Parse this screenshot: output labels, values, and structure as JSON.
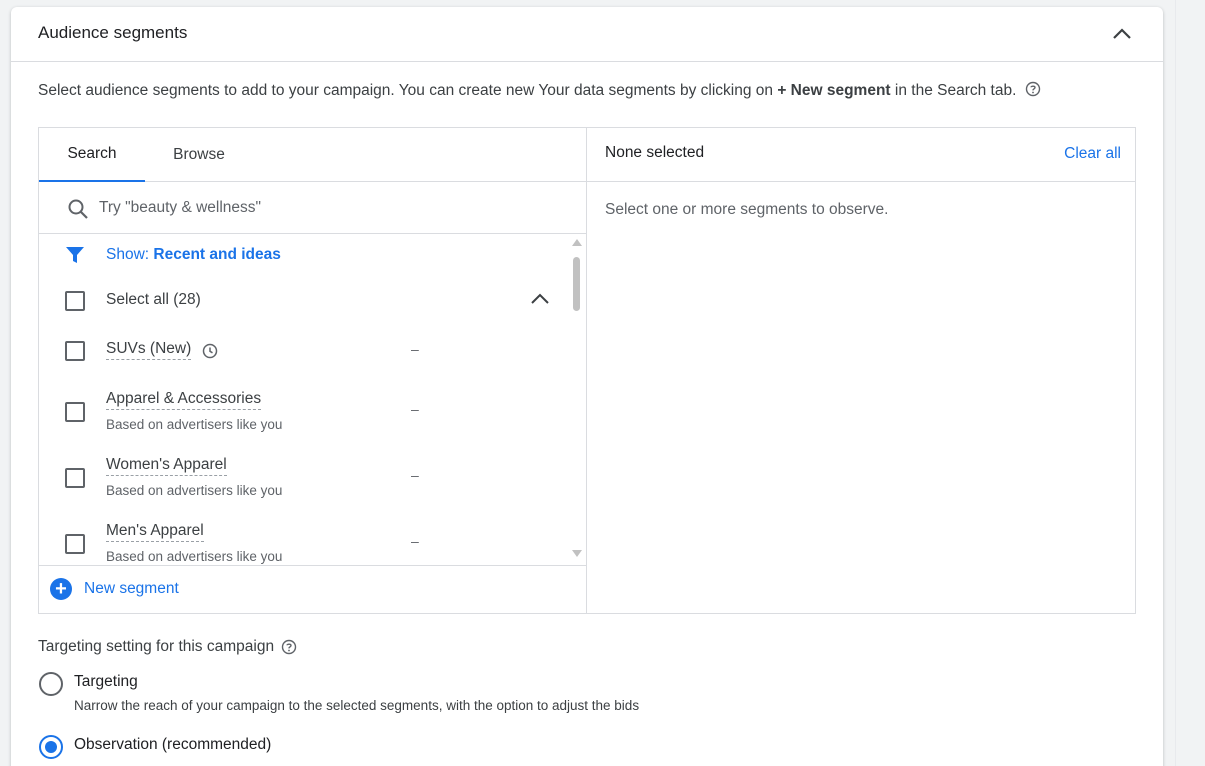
{
  "card": {
    "title": "Audience segments",
    "description_pre": "Select audience segments to add to your campaign. You can create new Your data segments by clicking on ",
    "description_bold": "+ New segment",
    "description_post": " in the Search tab."
  },
  "tabs": [
    {
      "label": "Search",
      "active": true
    },
    {
      "label": "Browse",
      "active": false
    }
  ],
  "search": {
    "placeholder": "Try \"beauty & wellness\""
  },
  "filter": {
    "prefix": "Show: ",
    "value": "Recent and ideas"
  },
  "select_all": {
    "label": "Select all (28)"
  },
  "segments": [
    {
      "name": "SUVs (New)",
      "sub": "",
      "value": "–",
      "has_clock": true
    },
    {
      "name": "Apparel & Accessories",
      "sub": "Based on advertisers like you",
      "value": "–"
    },
    {
      "name": "Women's Apparel",
      "sub": "Based on advertisers like you",
      "value": "–"
    },
    {
      "name": "Men's Apparel",
      "sub": "Based on advertisers like you",
      "value": "–"
    }
  ],
  "new_segment": {
    "label": "New segment"
  },
  "selection": {
    "status": "None selected",
    "clear_label": "Clear all",
    "empty_text": "Select one or more segments to observe."
  },
  "targeting": {
    "title": "Targeting setting for this campaign",
    "options": [
      {
        "label": "Targeting",
        "sub": "Narrow the reach of your campaign to the selected segments, with the option to adjust the bids",
        "selected": false
      },
      {
        "label": "Observation (recommended)",
        "selected": true
      }
    ]
  },
  "colors": {
    "accent": "#1a73e8",
    "text": "#3c4043",
    "border": "#dadce0"
  }
}
